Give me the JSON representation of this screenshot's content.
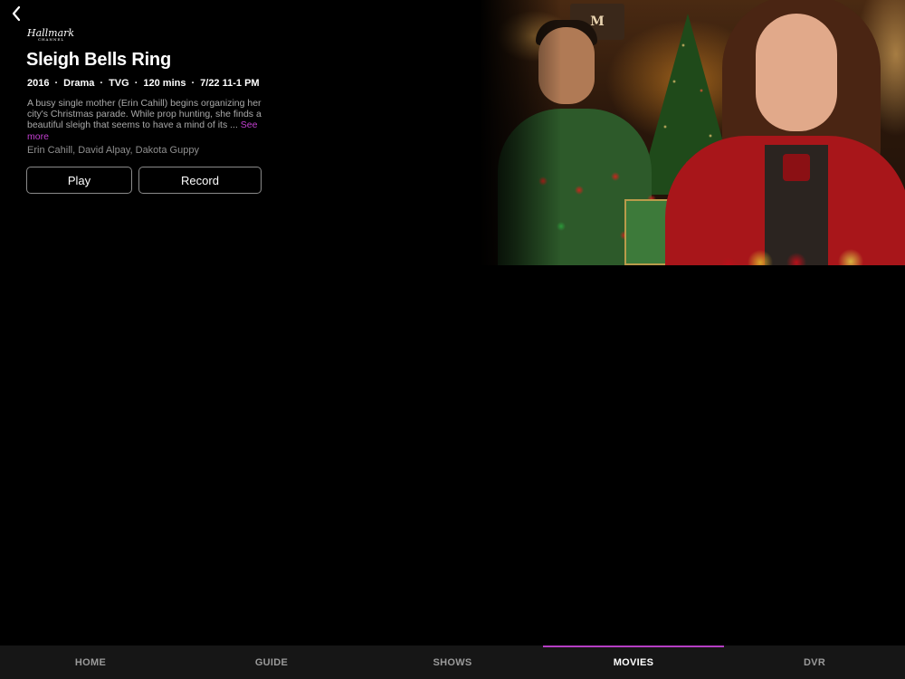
{
  "header": {
    "back_icon": "chevron-left-icon",
    "network_logo": "Hallmark",
    "network_logo_sub": "CHANNEL"
  },
  "program": {
    "title": "Sleigh Bells Ring",
    "year": "2016",
    "genre": "Drama",
    "rating": "TVG",
    "duration": "120 mins",
    "airtime": "7/22 11-1 PM",
    "separator": "·",
    "description": "A busy single mother (Erin Cahill) begins organizing her city's Christmas parade. While prop hunting, she finds a beautiful sleigh that seems to have a mind of its ... ",
    "see_more": "See more",
    "cast": "Erin Cahill, David Alpay, Dakota Guppy"
  },
  "actions": {
    "play_label": "Play",
    "record_label": "Record"
  },
  "hero": {
    "sign_text": "M"
  },
  "tabs": [
    {
      "label": "HOME",
      "active": false
    },
    {
      "label": "GUIDE",
      "active": false
    },
    {
      "label": "SHOWS",
      "active": false
    },
    {
      "label": "MOVIES",
      "active": true
    },
    {
      "label": "DVR",
      "active": false
    }
  ],
  "colors": {
    "accent": "#b53ec4",
    "see_more": "#c33fd1",
    "background": "#000000",
    "tabbar": "#161616"
  }
}
